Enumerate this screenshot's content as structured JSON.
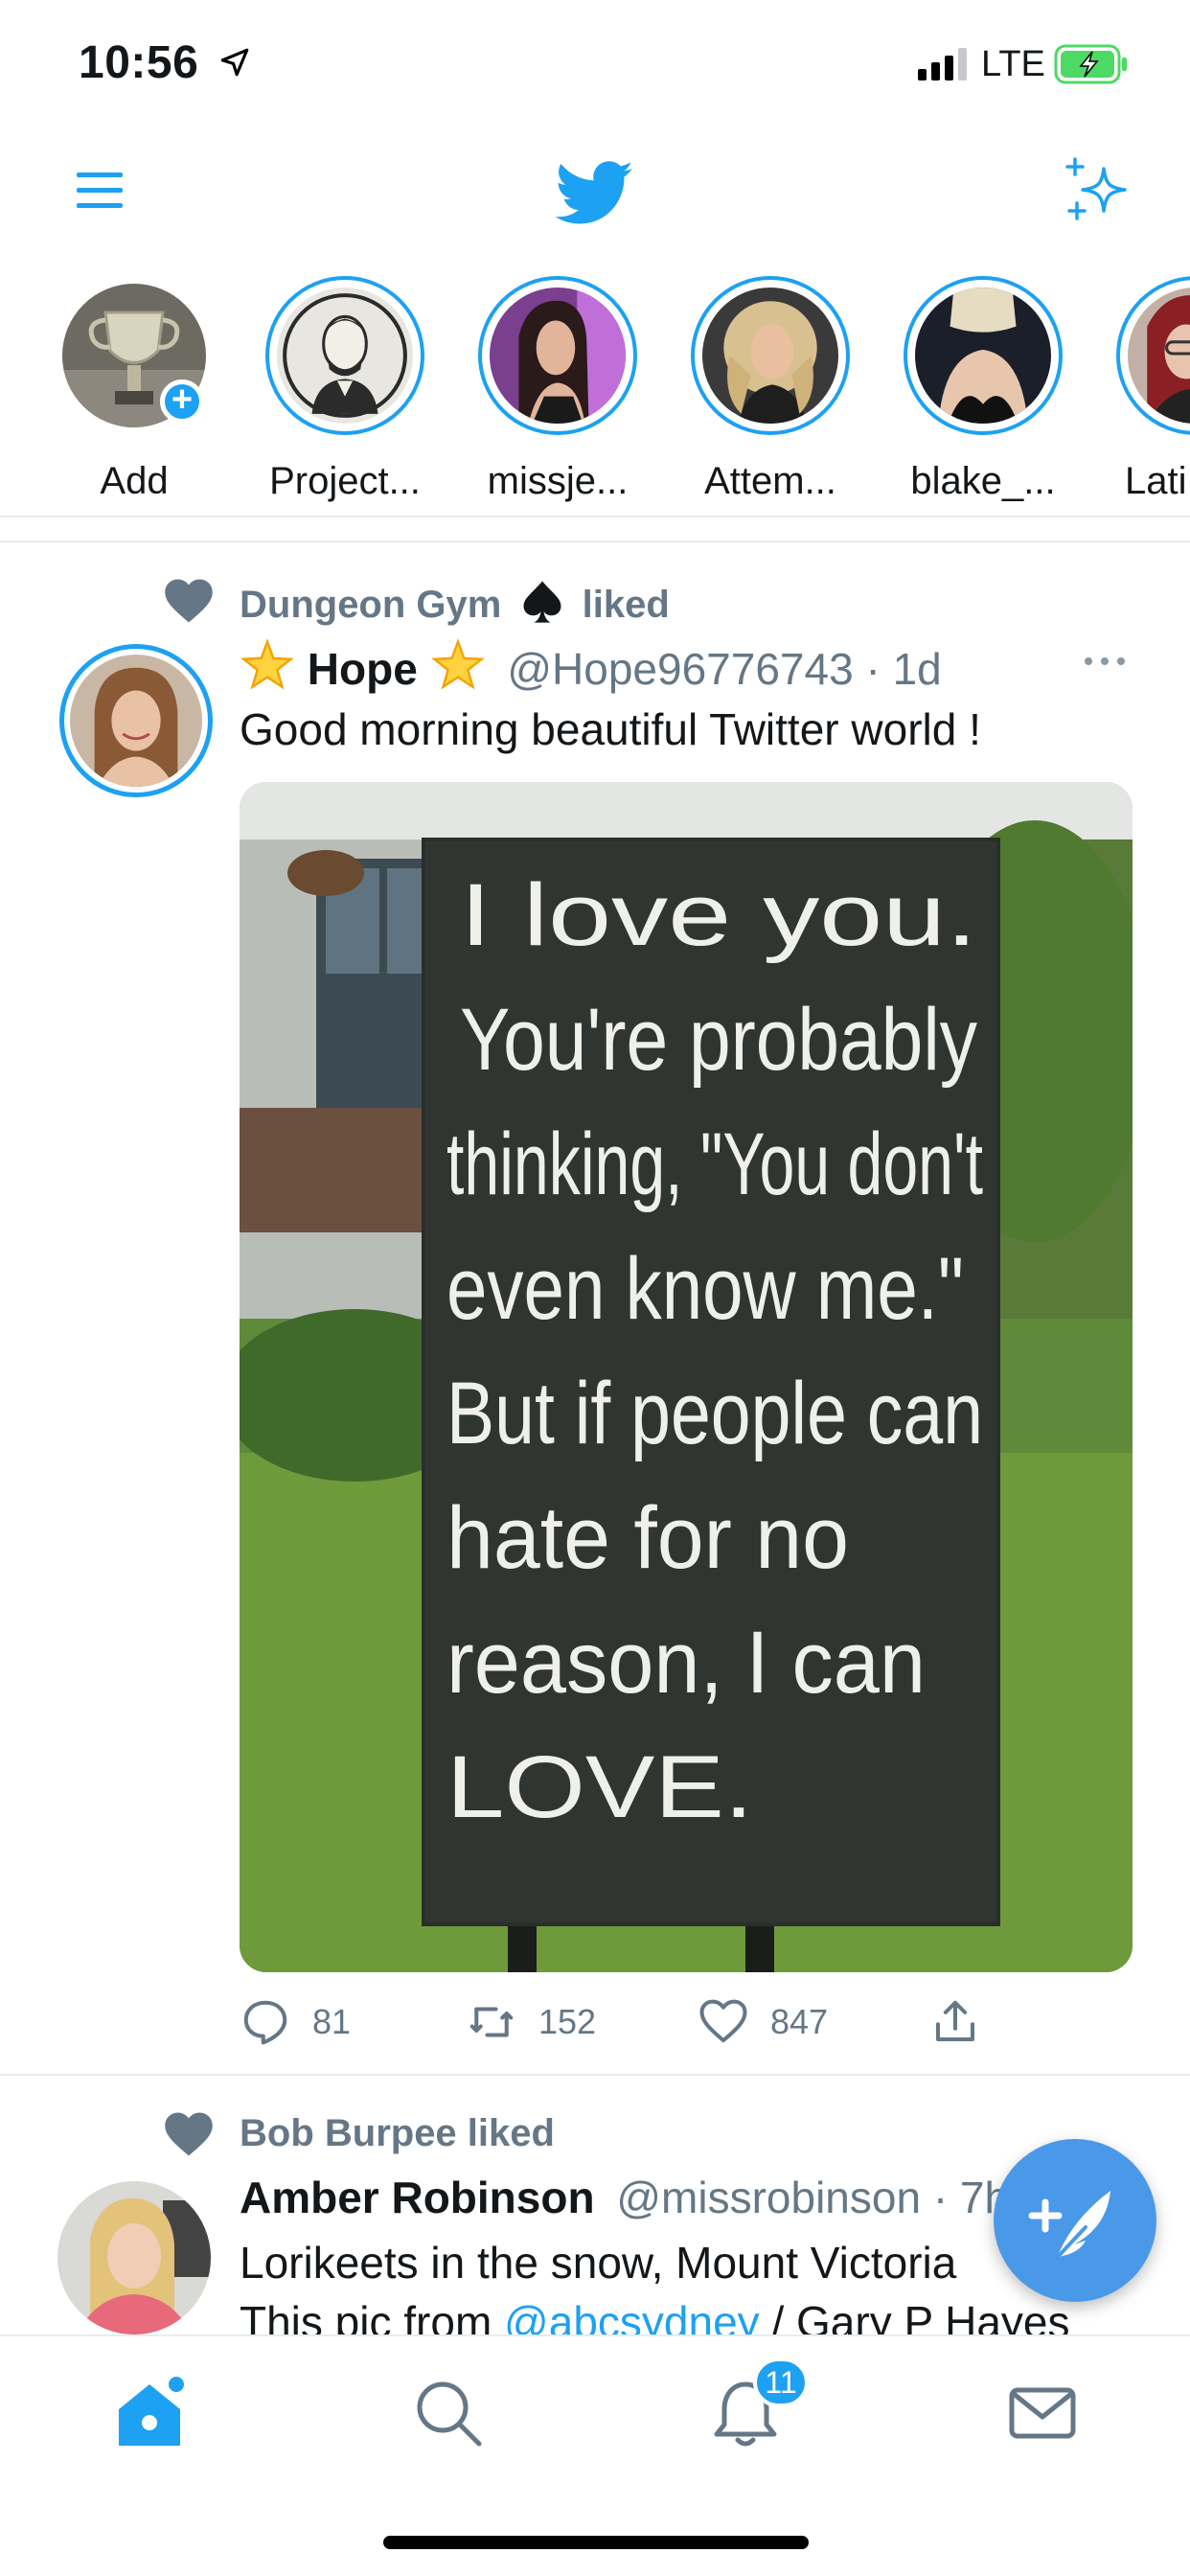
{
  "status_bar": {
    "time": "10:56",
    "network": "LTE"
  },
  "colors": {
    "accent": "#1da1f2",
    "secondary_text": "#657786",
    "divider": "#e6ecf0"
  },
  "nav": {
    "menu_icon": "hamburger-menu-icon",
    "logo_icon": "twitter-bird-icon",
    "sparkle_icon": "sparkle-icon"
  },
  "fleets": [
    {
      "label": "Add"
    },
    {
      "label": "Project..."
    },
    {
      "label": "missje..."
    },
    {
      "label": "Attem..."
    },
    {
      "label": "blake_..."
    },
    {
      "label": "Lati"
    }
  ],
  "tweet1": {
    "social_context": "Dungeon Gym",
    "social_suffix": "liked",
    "name": "Hope",
    "handle": "@Hope96776743",
    "time": "· 1d",
    "text": "Good morning beautiful Twitter world !",
    "media_text": [
      "I love you.",
      "You're probably",
      "thinking, \"You don't",
      "even know me.\"",
      "But if people can",
      "hate for no",
      "reason, I can",
      "LOVE."
    ],
    "replies": "81",
    "retweets": "152",
    "likes": "847"
  },
  "tweet2": {
    "social_context": "Bob Burpee liked",
    "name": "Amber Robinson",
    "handle": "@missrobinson",
    "time": "· 7h",
    "text_line1": "Lorikeets in the snow, Mount Victoria",
    "text_line2_prefix": "This pic from ",
    "text_line2_link": "@abcsydney",
    "text_line2_suffix": " / Gary P Hayes"
  },
  "tabbar": {
    "notification_count": "11"
  }
}
